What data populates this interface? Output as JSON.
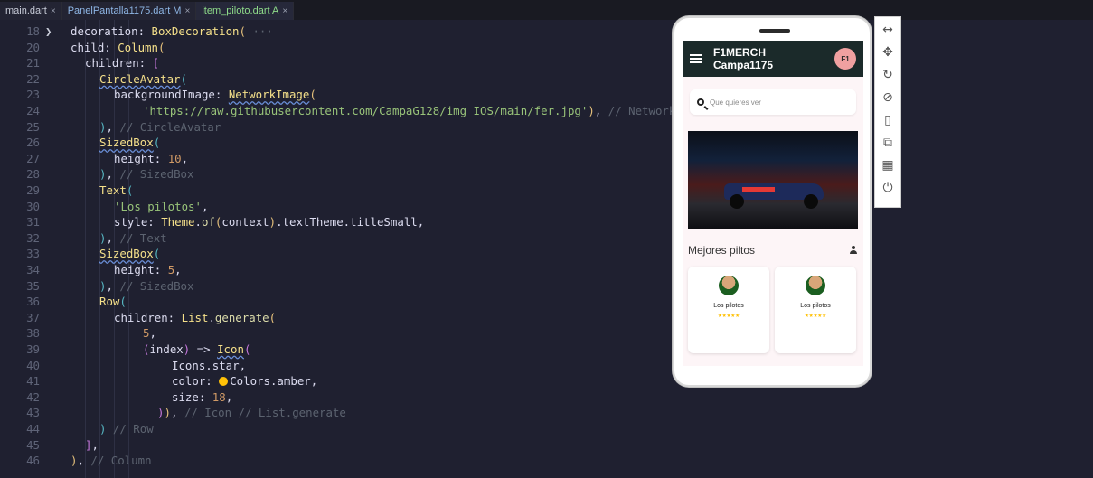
{
  "tabs": [
    {
      "label": "main.dart",
      "close": "×"
    },
    {
      "label": "PanelPantalla1175.dart M",
      "close": "×"
    },
    {
      "label": "item_piloto.dart A",
      "close": "×"
    }
  ],
  "code_lines": [
    {
      "ln": "18",
      "fold": "❯",
      "indent": 1,
      "html": "<span class='c-def'>decoration: </span><span class='c-cls'>BoxDecoration</span><span class='c-br1'>(</span><span class='c-cmt'> ···</span>"
    },
    {
      "ln": "20",
      "indent": 1,
      "html": "<span class='c-def'>child: </span><span class='c-cls'>Column</span><span class='c-br1'>(</span>"
    },
    {
      "ln": "21",
      "indent": 2,
      "html": "<span class='c-def'>children: </span><span class='c-br2'>[</span>"
    },
    {
      "ln": "22",
      "indent": 3,
      "html": "<span class='c-cls under'>CircleAvatar</span><span class='c-br3'>(</span>"
    },
    {
      "ln": "23",
      "indent": 4,
      "html": "<span class='c-def'>backgroundImage: </span><span class='c-cls under'>NetworkImage</span><span class='c-br1'>(</span>"
    },
    {
      "ln": "24",
      "indent": 6,
      "html": "<span class='c-str'>'https://raw.githubusercontent.com/CampaG128/img_IOS/main/fer.jpg'</span><span class='c-br1'>)</span><span class='c-def'>, </span><span class='c-cmt'>// NetworkImage</span>"
    },
    {
      "ln": "25",
      "indent": 3,
      "html": "<span class='c-br3'>)</span><span class='c-def'>, </span><span class='c-cmt'>// CircleAvatar</span>"
    },
    {
      "ln": "26",
      "indent": 3,
      "html": "<span class='c-cls under'>SizedBox</span><span class='c-br3'>(</span>"
    },
    {
      "ln": "27",
      "indent": 4,
      "html": "<span class='c-def'>height: </span><span class='c-num'>10</span><span class='c-def'>,</span>"
    },
    {
      "ln": "28",
      "indent": 3,
      "html": "<span class='c-br3'>)</span><span class='c-def'>, </span><span class='c-cmt'>// SizedBox</span>"
    },
    {
      "ln": "29",
      "indent": 3,
      "html": "<span class='c-cls'>Text</span><span class='c-br3'>(</span>"
    },
    {
      "ln": "30",
      "indent": 4,
      "html": "<span class='c-str'>'Los pilotos'</span><span class='c-def'>,</span>"
    },
    {
      "ln": "31",
      "indent": 4,
      "html": "<span class='c-def'>style: </span><span class='c-cls'>Theme</span><span class='c-def'>.</span><span class='c-fn'>of</span><span class='c-br1'>(</span><span class='c-def'>context</span><span class='c-br1'>)</span><span class='c-def'>.textTheme.titleSmall,</span>"
    },
    {
      "ln": "32",
      "indent": 3,
      "html": "<span class='c-br3'>)</span><span class='c-def'>, </span><span class='c-cmt'>// Text</span>"
    },
    {
      "ln": "33",
      "indent": 3,
      "html": "<span class='c-cls under'>SizedBox</span><span class='c-br3'>(</span>"
    },
    {
      "ln": "34",
      "indent": 4,
      "html": "<span class='c-def'>height: </span><span class='c-num'>5</span><span class='c-def'>,</span>"
    },
    {
      "ln": "35",
      "indent": 3,
      "html": "<span class='c-br3'>)</span><span class='c-def'>, </span><span class='c-cmt'>// SizedBox</span>"
    },
    {
      "ln": "36",
      "indent": 3,
      "html": "<span class='c-cls'>Row</span><span class='c-br3'>(</span>"
    },
    {
      "ln": "37",
      "indent": 4,
      "html": "<span class='c-def'>children: </span><span class='c-cls'>List</span><span class='c-def'>.</span><span class='c-fn'>generate</span><span class='c-br1'>(</span>"
    },
    {
      "ln": "38",
      "indent": 6,
      "html": "<span class='c-num'>5</span><span class='c-def'>,</span>"
    },
    {
      "ln": "39",
      "indent": 6,
      "html": "<span class='c-br2'>(</span><span class='c-def'>index</span><span class='c-br2'>)</span><span class='c-def'> =&gt; </span><span class='c-cls under'>Icon</span><span class='c-br2'>(</span>"
    },
    {
      "ln": "40",
      "indent": 8,
      "html": "<span class='c-def'>Icons.star,</span>"
    },
    {
      "ln": "41",
      "indent": 8,
      "html": "<span class='c-def'>color: </span><span class='amber-dot'></span><span class='c-def'>Colors.amber,</span>"
    },
    {
      "ln": "42",
      "indent": 8,
      "html": "<span class='c-def'>size: </span><span class='c-num'>18</span><span class='c-def'>,</span>"
    },
    {
      "ln": "43",
      "indent": 7,
      "html": "<span class='c-br2'>)</span><span class='c-br1'>)</span><span class='c-def'>, </span><span class='c-cmt'>// Icon // List.generate</span>"
    },
    {
      "ln": "44",
      "indent": 3,
      "html": "<span class='c-br3'>)</span><span class='c-cmt'> // Row</span>"
    },
    {
      "ln": "45",
      "indent": 2,
      "html": "<span class='c-br2'>]</span><span class='c-def'>,</span>"
    },
    {
      "ln": "46",
      "indent": 1,
      "html": "<span class='c-br1'>)</span><span class='c-def'>, </span><span class='c-cmt'>// Column</span>"
    }
  ],
  "app": {
    "title": "F1MERCH Campa1175",
    "search_placeholder": "Que quieres ver",
    "section_title": "Mejores piltos",
    "cards": [
      {
        "label": "Los pilotos",
        "stars": "★★★★★"
      },
      {
        "label": "Los pilotos",
        "stars": "★★★★★"
      }
    ]
  },
  "toolbar_icons": [
    "resize-icon",
    "move-icon",
    "rotate-icon",
    "no-touch-icon",
    "device-icon",
    "external-icon",
    "qr-icon",
    "power-icon"
  ]
}
